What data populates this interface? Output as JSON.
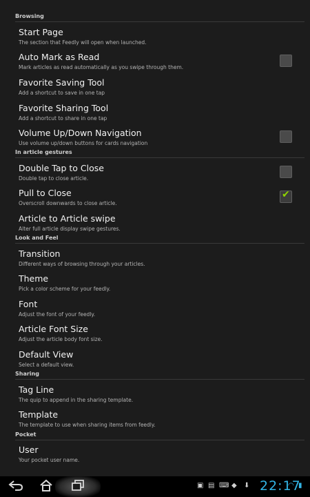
{
  "sections": [
    {
      "header": "Browsing",
      "items": [
        {
          "title": "Start Page",
          "summary": "The section that Feedly will open when launched."
        },
        {
          "title": "Auto Mark as Read",
          "summary": "Mark articles as read automatically as you swipe through them.",
          "checkbox": false
        },
        {
          "title": "Favorite Saving Tool",
          "summary": "Add a shortcut to save in one tap"
        },
        {
          "title": "Favorite Sharing Tool",
          "summary": "Add a shortcut to share in one tap"
        },
        {
          "title": "Volume Up/Down Navigation",
          "summary": "Use volume up/down buttons for cards navigation",
          "checkbox": false
        }
      ]
    },
    {
      "header": "In article gestures",
      "items": [
        {
          "title": "Double Tap to Close",
          "summary": "Double tap to close article.",
          "checkbox": false
        },
        {
          "title": "Pull to Close",
          "summary": "Overscroll downwards to close article.",
          "checkbox": true
        },
        {
          "title": "Article to Article swipe",
          "summary": "Alter full article display swipe gestures."
        }
      ]
    },
    {
      "header": "Look and Feel",
      "items": [
        {
          "title": "Transition",
          "summary": "Different ways of browsing through your articles."
        },
        {
          "title": "Theme",
          "summary": "Pick a color scheme for your feedly."
        },
        {
          "title": "Font",
          "summary": "Adjust the font of your feedly."
        },
        {
          "title": "Article Font Size",
          "summary": "Adjust the article body font size."
        },
        {
          "title": "Default View",
          "summary": "Select a default view."
        }
      ]
    },
    {
      "header": "Sharing",
      "items": [
        {
          "title": "Tag Line",
          "summary": "The quip to append in the sharing template."
        },
        {
          "title": "Template",
          "summary": "The template to use when sharing items from feedly."
        }
      ]
    },
    {
      "header": "Pocket",
      "items": [
        {
          "title": "User",
          "summary": "Your pocket user name."
        }
      ]
    }
  ],
  "navbar": {
    "back_icon": "back-icon",
    "home_icon": "home-icon",
    "recent_icon": "recent-apps-icon",
    "clock": "22:17",
    "accent": "#33b5e5"
  },
  "colors": {
    "check_accent": "#8fd400"
  }
}
